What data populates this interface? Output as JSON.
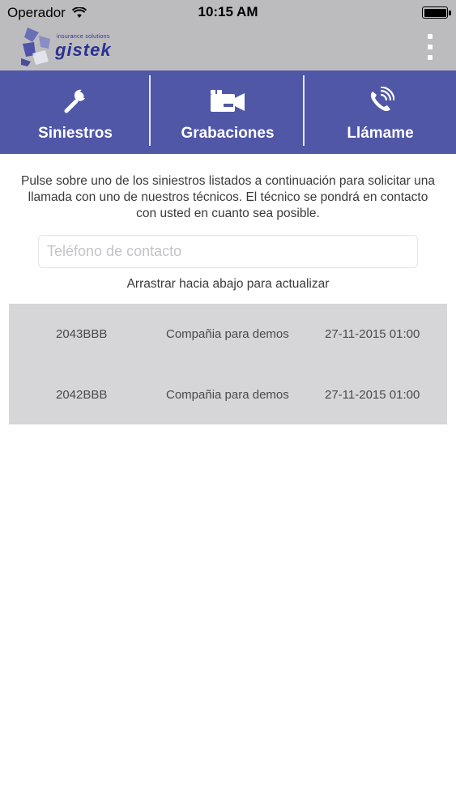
{
  "status_bar": {
    "carrier": "Operador",
    "time": "10:15 AM",
    "wifi_icon": "wifi-icon",
    "battery_icon": "battery-icon"
  },
  "header": {
    "logo_tagline": "insurance solutions",
    "logo_name": "gistek",
    "menu_icon": "more-vertical-icon"
  },
  "tabs": [
    {
      "label": "Siniestros",
      "icon": "wrench-icon"
    },
    {
      "label": "Grabaciones",
      "icon": "video-camera-icon"
    },
    {
      "label": "Llámame",
      "icon": "phone-call-icon"
    }
  ],
  "main": {
    "instructions": "Pulse sobre uno de los siniestros listados a continuación para solicitar una llamada con uno de nuestros técnicos. El técnico se pondrá en contacto con usted en cuanto sea posible.",
    "phone_placeholder": "Teléfono de contacto",
    "phone_value": "",
    "pull_hint": "Arrastrar hacia abajo para actualizar"
  },
  "claims": [
    {
      "id": "2043BBB",
      "company": "Compañia para demos",
      "date": "27-11-2015 01:00"
    },
    {
      "id": "2042BBB",
      "company": "Compañia para demos",
      "date": "27-11-2015 01:00"
    }
  ],
  "colors": {
    "header_bg": "#bcbcbf",
    "tabbar_bg": "#5057a6",
    "list_bg": "#d6d6d8",
    "brand": "#2d3192"
  }
}
